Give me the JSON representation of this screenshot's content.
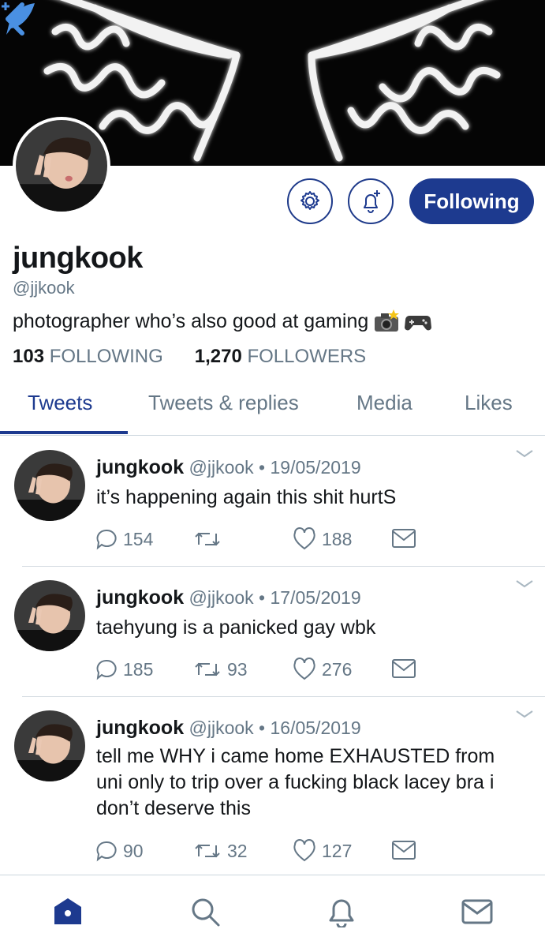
{
  "header": {
    "back_icon": "chevron-left-icon",
    "compose_icon": "compose-feather-icon"
  },
  "profile": {
    "display_name": "jungkook",
    "handle": "@jjkook",
    "bio": "photographer who’s also good at gaming",
    "bio_emojis": [
      "camera-flash-emoji",
      "game-controller-emoji"
    ],
    "following_count": "103",
    "following_label": "FOLLOWING",
    "followers_count": "1,270",
    "followers_label": "FOLLOWERS",
    "follow_button_label": "Following",
    "settings_icon": "gear-icon",
    "notify_icon": "bell-plus-icon"
  },
  "tabs": [
    {
      "label": "Tweets",
      "active": true
    },
    {
      "label": "Tweets & replies",
      "active": false
    },
    {
      "label": "Media",
      "active": false
    },
    {
      "label": "Likes",
      "active": false
    }
  ],
  "tweets": [
    {
      "name": "jungkook",
      "handle": "@jjkook",
      "date": "19/05/2019",
      "text": "it’s happening again this shit hurtS",
      "replies": "154",
      "retweets": "",
      "likes": "188"
    },
    {
      "name": "jungkook",
      "handle": "@jjkook",
      "date": "17/05/2019",
      "text": "taehyung is a panicked gay wbk",
      "replies": "185",
      "retweets": "93",
      "likes": "276"
    },
    {
      "name": "jungkook",
      "handle": "@jjkook",
      "date": "16/05/2019",
      "text": "tell me WHY i came home EXHAUSTED from uni only to trip over a fucking black lacey bra i don’t deserve this",
      "replies": "90",
      "retweets": "32",
      "likes": "127"
    }
  ],
  "bottom_nav": [
    "home-icon",
    "search-icon",
    "bell-icon",
    "mail-icon"
  ],
  "colors": {
    "accent": "#1d3a8f",
    "muted": "#657786",
    "text": "#14171a"
  },
  "sep": " • "
}
